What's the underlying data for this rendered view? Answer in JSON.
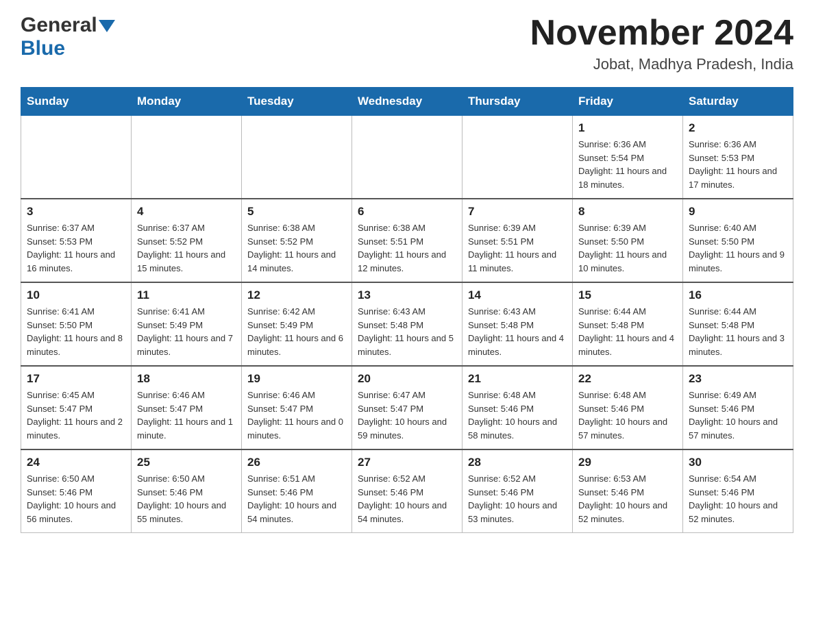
{
  "header": {
    "logo_general": "General",
    "logo_blue": "Blue",
    "month_title": "November 2024",
    "location": "Jobat, Madhya Pradesh, India"
  },
  "days_of_week": [
    "Sunday",
    "Monday",
    "Tuesday",
    "Wednesday",
    "Thursday",
    "Friday",
    "Saturday"
  ],
  "weeks": [
    [
      {
        "day": "",
        "info": ""
      },
      {
        "day": "",
        "info": ""
      },
      {
        "day": "",
        "info": ""
      },
      {
        "day": "",
        "info": ""
      },
      {
        "day": "",
        "info": ""
      },
      {
        "day": "1",
        "info": "Sunrise: 6:36 AM\nSunset: 5:54 PM\nDaylight: 11 hours and 18 minutes."
      },
      {
        "day": "2",
        "info": "Sunrise: 6:36 AM\nSunset: 5:53 PM\nDaylight: 11 hours and 17 minutes."
      }
    ],
    [
      {
        "day": "3",
        "info": "Sunrise: 6:37 AM\nSunset: 5:53 PM\nDaylight: 11 hours and 16 minutes."
      },
      {
        "day": "4",
        "info": "Sunrise: 6:37 AM\nSunset: 5:52 PM\nDaylight: 11 hours and 15 minutes."
      },
      {
        "day": "5",
        "info": "Sunrise: 6:38 AM\nSunset: 5:52 PM\nDaylight: 11 hours and 14 minutes."
      },
      {
        "day": "6",
        "info": "Sunrise: 6:38 AM\nSunset: 5:51 PM\nDaylight: 11 hours and 12 minutes."
      },
      {
        "day": "7",
        "info": "Sunrise: 6:39 AM\nSunset: 5:51 PM\nDaylight: 11 hours and 11 minutes."
      },
      {
        "day": "8",
        "info": "Sunrise: 6:39 AM\nSunset: 5:50 PM\nDaylight: 11 hours and 10 minutes."
      },
      {
        "day": "9",
        "info": "Sunrise: 6:40 AM\nSunset: 5:50 PM\nDaylight: 11 hours and 9 minutes."
      }
    ],
    [
      {
        "day": "10",
        "info": "Sunrise: 6:41 AM\nSunset: 5:50 PM\nDaylight: 11 hours and 8 minutes."
      },
      {
        "day": "11",
        "info": "Sunrise: 6:41 AM\nSunset: 5:49 PM\nDaylight: 11 hours and 7 minutes."
      },
      {
        "day": "12",
        "info": "Sunrise: 6:42 AM\nSunset: 5:49 PM\nDaylight: 11 hours and 6 minutes."
      },
      {
        "day": "13",
        "info": "Sunrise: 6:43 AM\nSunset: 5:48 PM\nDaylight: 11 hours and 5 minutes."
      },
      {
        "day": "14",
        "info": "Sunrise: 6:43 AM\nSunset: 5:48 PM\nDaylight: 11 hours and 4 minutes."
      },
      {
        "day": "15",
        "info": "Sunrise: 6:44 AM\nSunset: 5:48 PM\nDaylight: 11 hours and 4 minutes."
      },
      {
        "day": "16",
        "info": "Sunrise: 6:44 AM\nSunset: 5:48 PM\nDaylight: 11 hours and 3 minutes."
      }
    ],
    [
      {
        "day": "17",
        "info": "Sunrise: 6:45 AM\nSunset: 5:47 PM\nDaylight: 11 hours and 2 minutes."
      },
      {
        "day": "18",
        "info": "Sunrise: 6:46 AM\nSunset: 5:47 PM\nDaylight: 11 hours and 1 minute."
      },
      {
        "day": "19",
        "info": "Sunrise: 6:46 AM\nSunset: 5:47 PM\nDaylight: 11 hours and 0 minutes."
      },
      {
        "day": "20",
        "info": "Sunrise: 6:47 AM\nSunset: 5:47 PM\nDaylight: 10 hours and 59 minutes."
      },
      {
        "day": "21",
        "info": "Sunrise: 6:48 AM\nSunset: 5:46 PM\nDaylight: 10 hours and 58 minutes."
      },
      {
        "day": "22",
        "info": "Sunrise: 6:48 AM\nSunset: 5:46 PM\nDaylight: 10 hours and 57 minutes."
      },
      {
        "day": "23",
        "info": "Sunrise: 6:49 AM\nSunset: 5:46 PM\nDaylight: 10 hours and 57 minutes."
      }
    ],
    [
      {
        "day": "24",
        "info": "Sunrise: 6:50 AM\nSunset: 5:46 PM\nDaylight: 10 hours and 56 minutes."
      },
      {
        "day": "25",
        "info": "Sunrise: 6:50 AM\nSunset: 5:46 PM\nDaylight: 10 hours and 55 minutes."
      },
      {
        "day": "26",
        "info": "Sunrise: 6:51 AM\nSunset: 5:46 PM\nDaylight: 10 hours and 54 minutes."
      },
      {
        "day": "27",
        "info": "Sunrise: 6:52 AM\nSunset: 5:46 PM\nDaylight: 10 hours and 54 minutes."
      },
      {
        "day": "28",
        "info": "Sunrise: 6:52 AM\nSunset: 5:46 PM\nDaylight: 10 hours and 53 minutes."
      },
      {
        "day": "29",
        "info": "Sunrise: 6:53 AM\nSunset: 5:46 PM\nDaylight: 10 hours and 52 minutes."
      },
      {
        "day": "30",
        "info": "Sunrise: 6:54 AM\nSunset: 5:46 PM\nDaylight: 10 hours and 52 minutes."
      }
    ]
  ]
}
